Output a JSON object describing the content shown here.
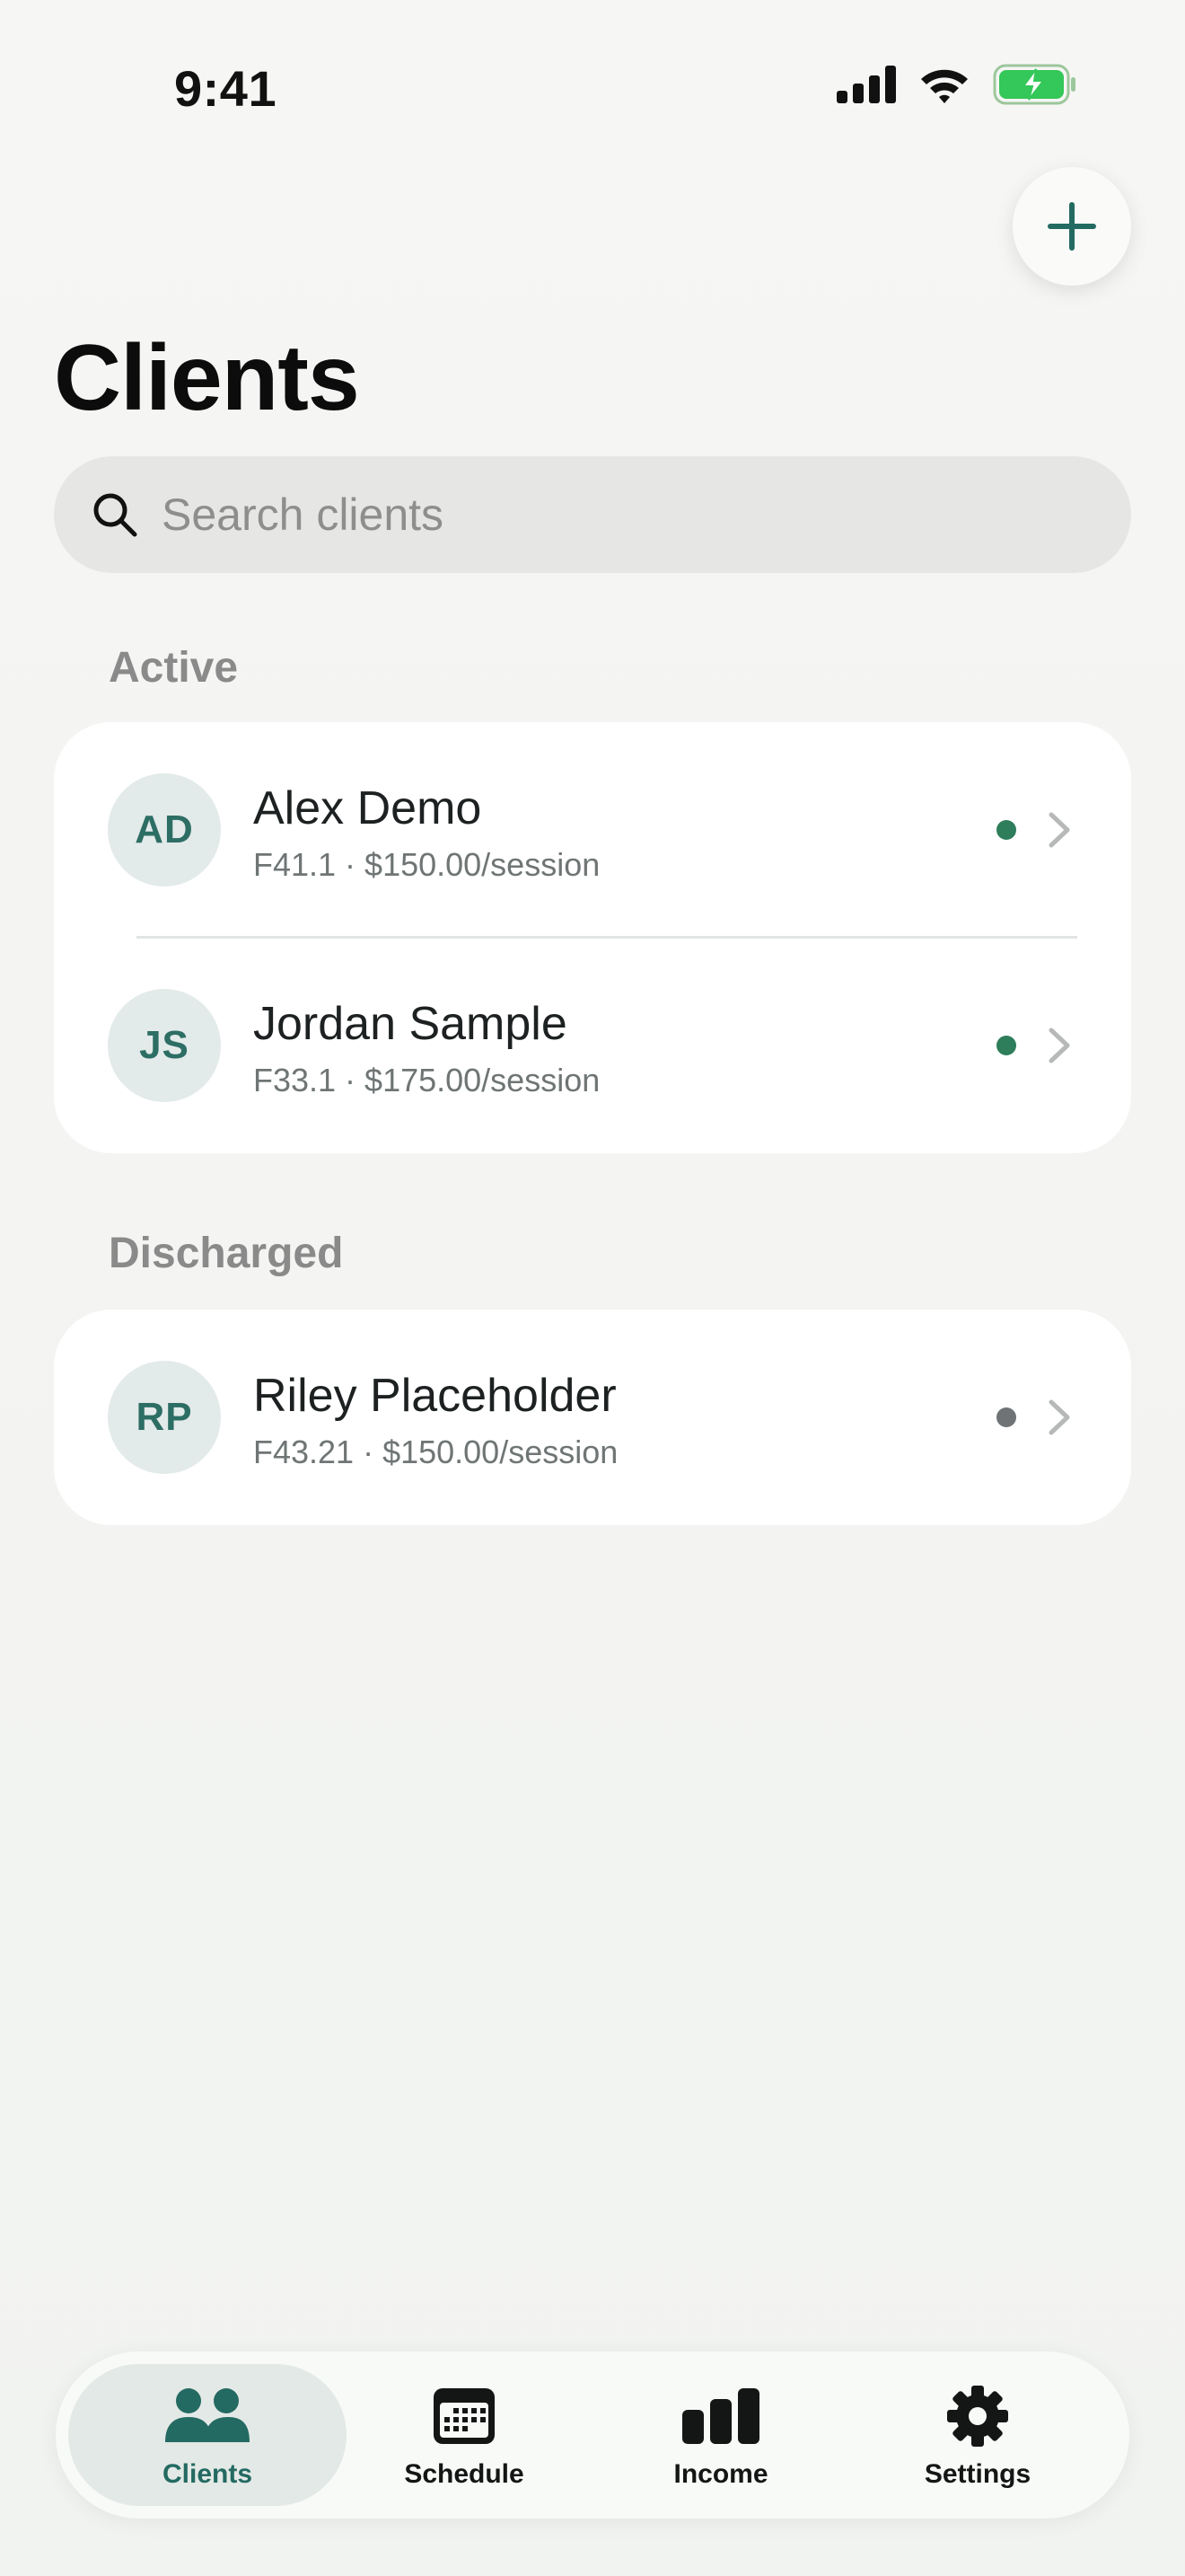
{
  "status_bar": {
    "time": "9:41",
    "icons": [
      "signal-icon",
      "wifi-icon",
      "battery-charging-icon"
    ]
  },
  "header": {
    "title": "Clients",
    "add_icon": "plus-icon"
  },
  "search": {
    "placeholder": "Search clients",
    "value": ""
  },
  "sections": [
    {
      "label": "Active",
      "clients": [
        {
          "initials": "AD",
          "name": "Alex Demo",
          "meta": "F41.1 · $150.00/session",
          "status": "active"
        },
        {
          "initials": "JS",
          "name": "Jordan Sample",
          "meta": "F33.1 · $175.00/session",
          "status": "active"
        }
      ]
    },
    {
      "label": "Discharged",
      "clients": [
        {
          "initials": "RP",
          "name": "Riley Placeholder",
          "meta": "F43.21 · $150.00/session",
          "status": "discharged"
        }
      ]
    }
  ],
  "tabs": [
    {
      "label": "Clients",
      "icon": "people-icon",
      "active": true
    },
    {
      "label": "Schedule",
      "icon": "calendar-icon",
      "active": false
    },
    {
      "label": "Income",
      "icon": "bar-chart-icon",
      "active": false
    },
    {
      "label": "Settings",
      "icon": "gear-icon",
      "active": false
    }
  ],
  "colors": {
    "accent": "#236a62",
    "active_dot": "#2e7d5b",
    "discharged_dot": "#6f7375",
    "avatar_bg": "#e3eaea"
  }
}
